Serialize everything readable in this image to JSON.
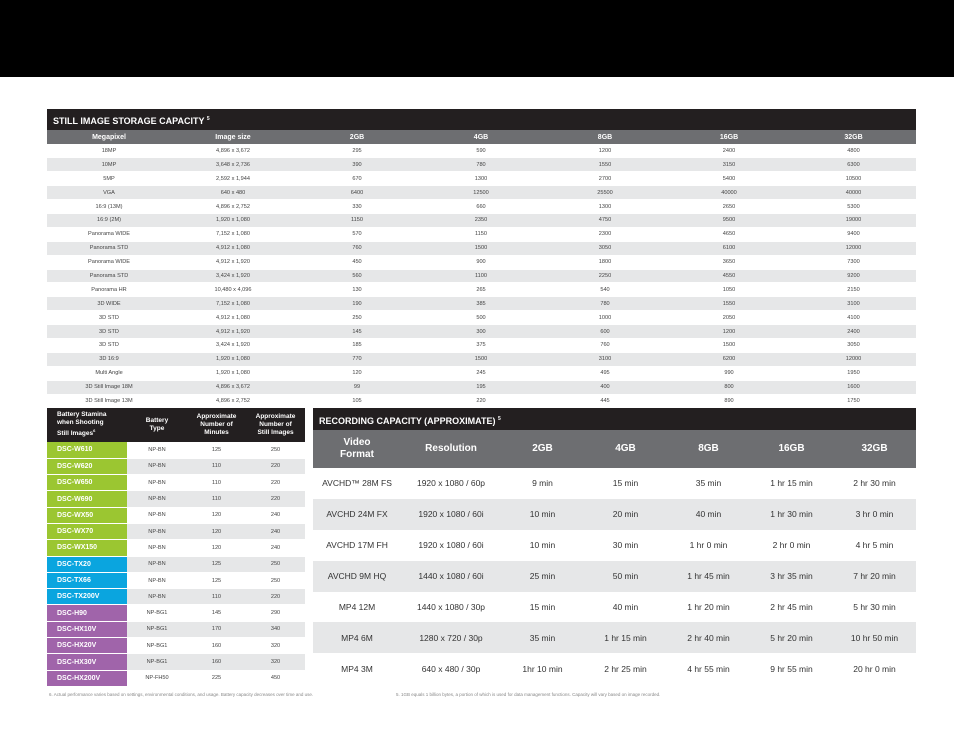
{
  "still": {
    "title": "STILL IMAGE STORAGE CAPACITY",
    "title_note": "5",
    "headers": [
      "Megapixel",
      "Image size",
      "2GB",
      "4GB",
      "8GB",
      "16GB",
      "32GB"
    ],
    "rows": [
      [
        "18MP",
        "4,896 x 3,672",
        "295",
        "590",
        "1200",
        "2400",
        "4800"
      ],
      [
        "10MP",
        "3,648 x 2,736",
        "390",
        "780",
        "1550",
        "3150",
        "6300"
      ],
      [
        "5MP",
        "2,592 x 1,944",
        "670",
        "1300",
        "2700",
        "5400",
        "10500"
      ],
      [
        "VGA",
        "640 x 480",
        "6400",
        "12500",
        "25500",
        "40000",
        "40000"
      ],
      [
        "16:9 (13M)",
        "4,896 x 2,752",
        "330",
        "660",
        "1300",
        "2650",
        "5300"
      ],
      [
        "16:9 (2M)",
        "1,920 x 1,080",
        "1150",
        "2350",
        "4750",
        "9500",
        "19000"
      ],
      [
        "Panorama WIDE",
        "7,152 x 1,080",
        "570",
        "1150",
        "2300",
        "4650",
        "9400"
      ],
      [
        "Panorama STD",
        "4,912 x 1,080",
        "760",
        "1500",
        "3050",
        "6100",
        "12000"
      ],
      [
        "Panorama WIDE",
        "4,912 x 1,920",
        "450",
        "900",
        "1800",
        "3650",
        "7300"
      ],
      [
        "Panorama STD",
        "3,424 x 1,920",
        "560",
        "1100",
        "2250",
        "4550",
        "9200"
      ],
      [
        "Panorama HR",
        "10,480 x 4,096",
        "130",
        "265",
        "540",
        "1050",
        "2150"
      ],
      [
        "3D WIDE",
        "7,152 x 1,080",
        "190",
        "385",
        "780",
        "1550",
        "3100"
      ],
      [
        "3D STD",
        "4,912 x 1,080",
        "250",
        "500",
        "1000",
        "2050",
        "4100"
      ],
      [
        "3D STD",
        "4,912 x 1,920",
        "145",
        "300",
        "600",
        "1200",
        "2400"
      ],
      [
        "3D STD",
        "3,424 x 1,920",
        "185",
        "375",
        "760",
        "1500",
        "3050"
      ],
      [
        "3D 16:9",
        "1,920 x 1,080",
        "770",
        "1500",
        "3100",
        "6200",
        "12000"
      ],
      [
        "Multi Angle",
        "1,920 x 1,080",
        "120",
        "245",
        "495",
        "990",
        "1950"
      ],
      [
        "3D Still Image 18M",
        "4,896 x 3,672",
        "99",
        "195",
        "400",
        "800",
        "1600"
      ],
      [
        "3D Still Image 13M",
        "4,896 x 2,752",
        "105",
        "220",
        "445",
        "890",
        "1750"
      ]
    ]
  },
  "battery": {
    "headers": {
      "model_line1": "Battery Stamina",
      "model_line2": "when Shooting",
      "model_line3": "Still Images",
      "model_note": "6",
      "type_line1": "Battery",
      "type_line2": "Type",
      "min_line1": "Approximate",
      "min_line2": "Number of",
      "min_line3": "Minutes",
      "img_line1": "Approximate",
      "img_line2": "Number of",
      "img_line3": "Still Images"
    },
    "group_colors": {
      "green": "#9bc631",
      "blue": "#0aa5df",
      "purple": "#a064aa"
    },
    "rows": [
      {
        "model": "DSC-W610",
        "type": "NP-BN",
        "minutes": "125",
        "images": "250",
        "group": "green"
      },
      {
        "model": "DSC-W620",
        "type": "NP-BN",
        "minutes": "110",
        "images": "220",
        "group": "green"
      },
      {
        "model": "DSC-W650",
        "type": "NP-BN",
        "minutes": "110",
        "images": "220",
        "group": "green"
      },
      {
        "model": "DSC-W690",
        "type": "NP-BN",
        "minutes": "110",
        "images": "220",
        "group": "green"
      },
      {
        "model": "DSC-WX50",
        "type": "NP-BN",
        "minutes": "120",
        "images": "240",
        "group": "green"
      },
      {
        "model": "DSC-WX70",
        "type": "NP-BN",
        "minutes": "120",
        "images": "240",
        "group": "green"
      },
      {
        "model": "DSC-WX150",
        "type": "NP-BN",
        "minutes": "120",
        "images": "240",
        "group": "green"
      },
      {
        "model": "DSC-TX20",
        "type": "NP-BN",
        "minutes": "125",
        "images": "250",
        "group": "blue"
      },
      {
        "model": "DSC-TX66",
        "type": "NP-BN",
        "minutes": "125",
        "images": "250",
        "group": "blue"
      },
      {
        "model": "DSC-TX200V",
        "type": "NP-BN",
        "minutes": "110",
        "images": "220",
        "group": "blue"
      },
      {
        "model": "DSC-H90",
        "type": "NP-BG1",
        "minutes": "145",
        "images": "290",
        "group": "purple"
      },
      {
        "model": "DSC-HX10V",
        "type": "NP-BG1",
        "minutes": "170",
        "images": "340",
        "group": "purple"
      },
      {
        "model": "DSC-HX20V",
        "type": "NP-BG1",
        "minutes": "160",
        "images": "320",
        "group": "purple"
      },
      {
        "model": "DSC-HX30V",
        "type": "NP-BG1",
        "minutes": "160",
        "images": "320",
        "group": "purple"
      },
      {
        "model": "DSC-HX200V",
        "type": "NP-FH50",
        "minutes": "225",
        "images": "450",
        "group": "purple"
      }
    ]
  },
  "recording": {
    "title": "RECORDING CAPACITY (APPROXIMATE)",
    "title_note": "5",
    "headers": {
      "format_line1": "Video",
      "format_line2": "Format",
      "resolution": "Resolution",
      "c2": "2GB",
      "c4": "4GB",
      "c8": "8GB",
      "c16": "16GB",
      "c32": "32GB"
    },
    "rows": [
      [
        "AVCHD™ 28M FS",
        "1920 x 1080 / 60p",
        "9 min",
        "15 min",
        "35 min",
        "1 hr 15 min",
        "2 hr 30 min"
      ],
      [
        "AVCHD 24M FX",
        "1920 x 1080 / 60i",
        "10 min",
        "20 min",
        "40 min",
        "1 hr 30 min",
        "3 hr 0 min"
      ],
      [
        "AVCHD 17M FH",
        "1920 x 1080 / 60i",
        "10 min",
        "30 min",
        "1 hr 0 min",
        "2 hr 0 min",
        "4 hr 5 min"
      ],
      [
        "AVCHD 9M HQ",
        "1440  x 1080 / 60i",
        "25 min",
        "50 min",
        "1 hr 45 min",
        "3 hr 35 min",
        "7 hr 20 min"
      ],
      [
        "MP4 12M",
        "1440  x 1080 / 30p",
        "15 min",
        "40 min",
        "1 hr 20 min",
        "2 hr 45 min",
        "5 hr 30 min"
      ],
      [
        "MP4 6M",
        "1280 x 720 / 30p",
        "35 min",
        "1 hr 15 min",
        "2 hr 40 min",
        "5 hr 20 min",
        "10 hr 50 min"
      ],
      [
        "MP4 3M",
        "640 x 480 / 30p",
        "1hr 10 min",
        "2 hr 25 min",
        "4 hr 55 min",
        "9 hr 55 min",
        "20 hr 0 min"
      ]
    ]
  },
  "footnotes": {
    "note6": "6.  Actual performance varies based on settings, environmental conditions, and usage. Battery capacity decreases over time and use.",
    "note5": "5.  1GB equals 1 billion bytes, a portion of which is used for data management functions. Capacity will vary based on image recorded."
  }
}
